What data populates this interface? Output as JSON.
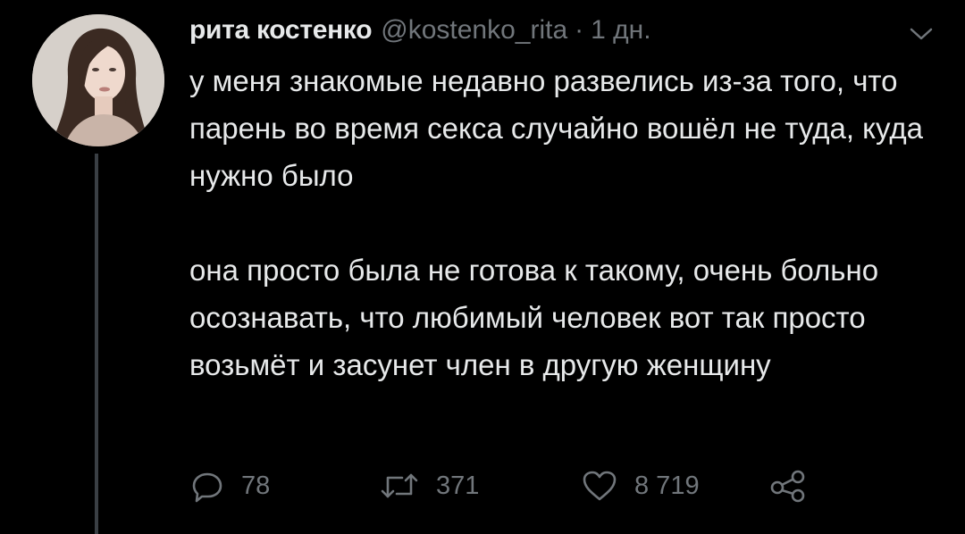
{
  "tweet": {
    "author_name": "рита костенко",
    "handle": "@kostenko_rita",
    "separator": "·",
    "time": "1 дн.",
    "paragraphs": [
      "у меня знакомые недавно развелись из-за того, что парень во время секса случайно вошёл не туда, куда нужно было",
      "она просто была не готова к такому, очень больно осознавать, что любимый человек вот так просто возьмёт и засунет член в другую женщину"
    ]
  },
  "actions": {
    "replies": "78",
    "retweets": "371",
    "likes": "8 719",
    "icons": [
      "reply-icon",
      "retweet-icon",
      "like-icon",
      "share-icon",
      "chevron-down-icon"
    ]
  },
  "colors": {
    "background": "#000000",
    "text": "#e7e9ea",
    "muted": "#71767b",
    "thread_line": "#3a3f44"
  }
}
